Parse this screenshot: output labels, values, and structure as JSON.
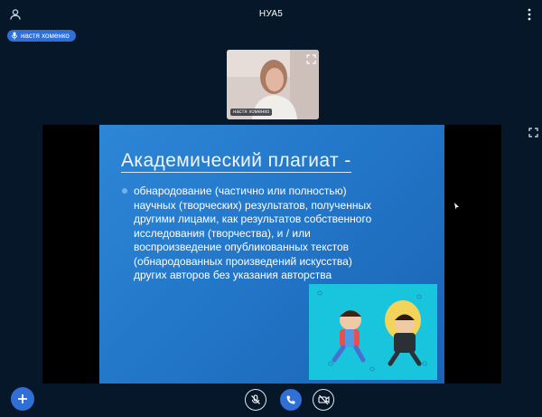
{
  "header": {
    "title": "НУА5"
  },
  "talking": {
    "name": "настя хоменко"
  },
  "webcam": {
    "name": "настя хоменко"
  },
  "slide": {
    "title": "Академический плагиат -",
    "lines": [
      "обнародование (частично или полностью)",
      "научных (творческих) результатов, полученных",
      "другими лицами, как результатов собственного",
      "исследования (творчества), и / или",
      "воспроизведение опубликованных текстов",
      "(обнародованных произведений искусства)",
      "других авторов без указания авторства"
    ]
  },
  "colors": {
    "background": "#06172a",
    "accent": "#2f6fd6",
    "slide": "#2377c9"
  },
  "icons": [
    "user-icon",
    "more-vertical-icon",
    "microphone-icon",
    "fullscreen-icon",
    "plus-icon",
    "mic-off-icon",
    "phone-icon",
    "video-off-icon"
  ]
}
